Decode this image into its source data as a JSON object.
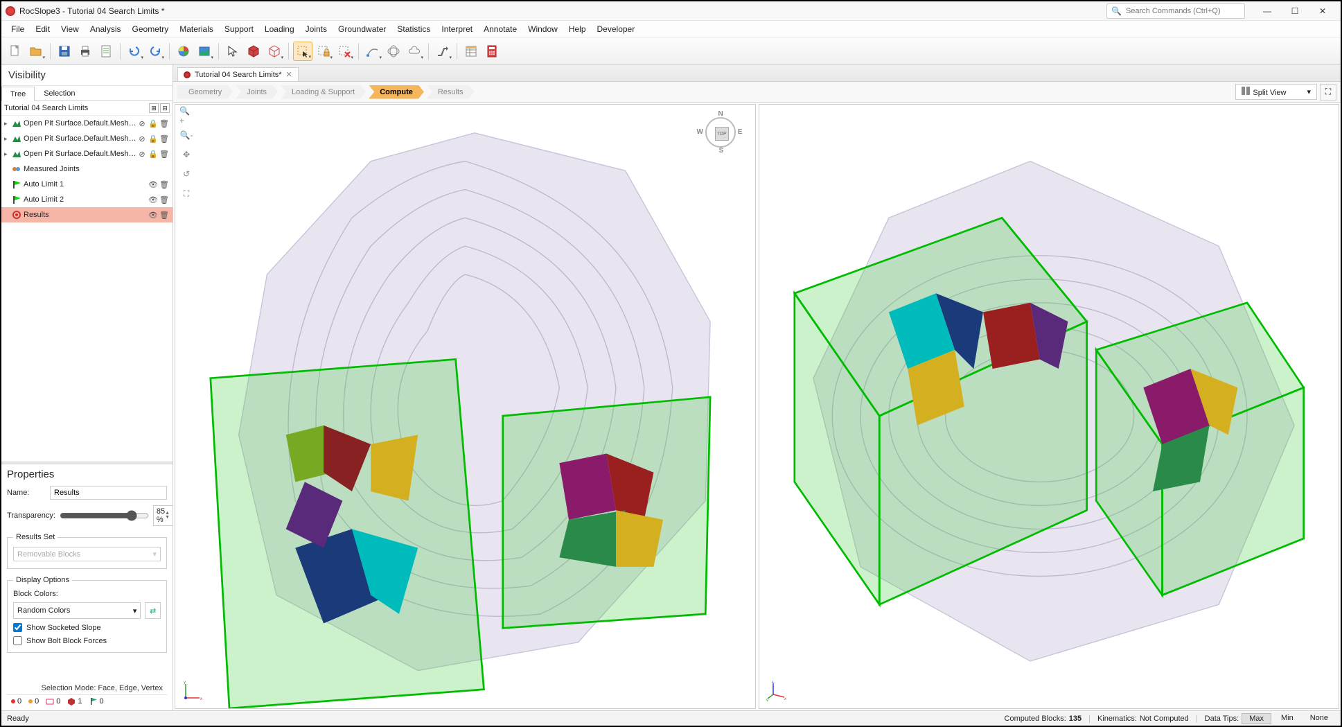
{
  "app": {
    "title": "RocSlope3 - Tutorial 04 Search Limits *",
    "search_placeholder": "Search Commands (Ctrl+Q)"
  },
  "menu": [
    "File",
    "Edit",
    "View",
    "Analysis",
    "Geometry",
    "Materials",
    "Support",
    "Loading",
    "Joints",
    "Groundwater",
    "Statistics",
    "Interpret",
    "Annotate",
    "Window",
    "Help",
    "Developer"
  ],
  "visibility": {
    "header": "Visibility",
    "tabs": [
      "Tree",
      "Selection"
    ],
    "active_tab": 0,
    "tree_header": "Tutorial 04 Search Limits",
    "items": [
      {
        "label": "Open Pit Surface.Default.Mesh_ext.",
        "arrow": true,
        "icon": "terrain",
        "eye": "hidden",
        "lock": true,
        "trash": true,
        "selected": false
      },
      {
        "label": "Open Pit Surface.Default.Mesh_ext.",
        "arrow": true,
        "icon": "terrain",
        "eye": "hidden",
        "lock": true,
        "trash": true,
        "selected": false
      },
      {
        "label": "Open Pit Surface.Default.Mesh_ext.",
        "arrow": true,
        "icon": "terrain",
        "eye": "hidden",
        "lock": true,
        "trash": true,
        "selected": false
      },
      {
        "label": "Measured Joints",
        "arrow": false,
        "icon": "joints",
        "eye": "none",
        "lock": false,
        "trash": false,
        "selected": false
      },
      {
        "label": "Auto Limit 1",
        "arrow": false,
        "icon": "flag-green",
        "eye": "visible",
        "lock": false,
        "trash": true,
        "selected": false
      },
      {
        "label": "Auto Limit 2",
        "arrow": false,
        "icon": "flag-green",
        "eye": "visible",
        "lock": false,
        "trash": true,
        "selected": false
      },
      {
        "label": "Results",
        "arrow": false,
        "icon": "results",
        "eye": "visible",
        "lock": false,
        "trash": true,
        "selected": true
      }
    ]
  },
  "properties": {
    "header": "Properties",
    "name_label": "Name:",
    "name_value": "Results",
    "transparency_label": "Transparency:",
    "transparency_value": "85 %",
    "transparency_percent": 85,
    "results_set": {
      "legend": "Results Set",
      "value": "Removable Blocks"
    },
    "display_options": {
      "legend": "Display Options",
      "block_colors_label": "Block Colors:",
      "block_colors_value": "Random Colors",
      "show_socketed": {
        "label": "Show Socketed Slope",
        "checked": true
      },
      "show_bolt": {
        "label": "Show Bolt Block Forces",
        "checked": false
      }
    },
    "selection_mode": "Selection Mode: Face, Edge, Vertex",
    "counters": [
      {
        "color": "#d33",
        "value": "0"
      },
      {
        "color": "#e8a030",
        "value": "0"
      },
      {
        "color": "#d36",
        "value": "0",
        "box": true
      },
      {
        "color": "#b33",
        "value": "1",
        "cube": true
      },
      {
        "color": "#2a8",
        "value": "0",
        "flag": true
      }
    ]
  },
  "doc_tab": {
    "title": "Tutorial 04 Search Limits*"
  },
  "workflow": {
    "steps": [
      "Geometry",
      "Joints",
      "Loading & Support",
      "Compute",
      "Results"
    ],
    "active": 3
  },
  "view_switch": {
    "label": "Split View"
  },
  "compass": {
    "top": "TOP",
    "n": "N",
    "s": "S",
    "e": "E",
    "w": "W"
  },
  "status": {
    "ready": "Ready",
    "computed_blocks_label": "Computed Blocks:",
    "computed_blocks_value": "135",
    "kinematics_label": "Kinematics:",
    "kinematics_value": "Not Computed",
    "data_tips_label": "Data Tips:",
    "tips": [
      "Max",
      "Min",
      "None"
    ],
    "active_tip": 0
  }
}
